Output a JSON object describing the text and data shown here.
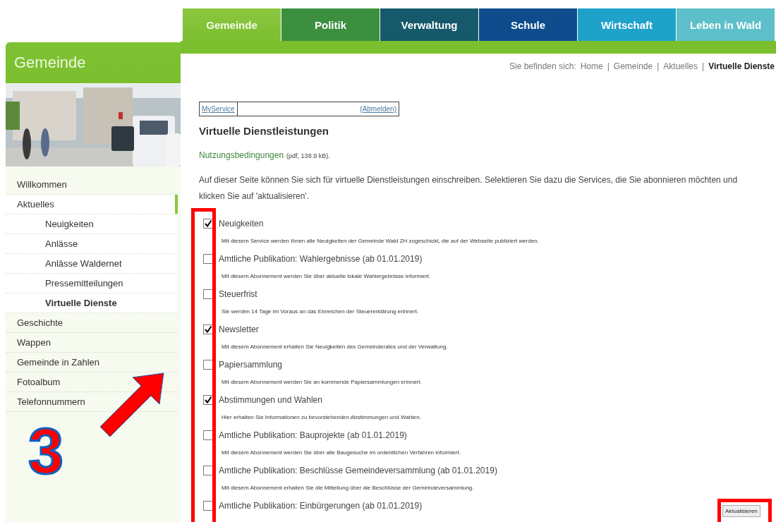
{
  "tabs": [
    {
      "label": "Gemeinde",
      "selected": true,
      "color": "#8cc63f"
    },
    {
      "label": "Politik",
      "selected": false,
      "color": "#3b8f3e"
    },
    {
      "label": "Verwaltung",
      "selected": false,
      "color": "#15596b"
    },
    {
      "label": "Schule",
      "selected": false,
      "color": "#0e4c8e"
    },
    {
      "label": "Wirtschaft",
      "selected": false,
      "color": "#1ea2c9"
    },
    {
      "label": "Leben in Wald",
      "selected": false,
      "color": "#5dbfc9"
    }
  ],
  "sidebar": {
    "title": "Gemeinde",
    "items": [
      {
        "label": "Willkommen",
        "selected": false,
        "expanded": false
      },
      {
        "label": "Aktuelles",
        "selected": false,
        "expanded": true,
        "children": [
          {
            "label": "Neuigkeiten",
            "selected": false
          },
          {
            "label": "Anlässe",
            "selected": false
          },
          {
            "label": "Anlässe Waldernet",
            "selected": false
          },
          {
            "label": "Pressemitteilungen",
            "selected": false
          },
          {
            "label": "Virtuelle Dienste",
            "selected": true
          }
        ]
      },
      {
        "label": "Geschichte",
        "selected": false,
        "expanded": false
      },
      {
        "label": "Wappen",
        "selected": false,
        "expanded": false
      },
      {
        "label": "Gemeinde in Zahlen",
        "selected": false,
        "expanded": false
      },
      {
        "label": "Fotoalbum",
        "selected": false,
        "expanded": false
      },
      {
        "label": "Telefonnummern",
        "selected": false,
        "expanded": false
      }
    ]
  },
  "breadcrumb": {
    "prefix": "Sie befinden sich:",
    "separator": "|",
    "items": [
      {
        "label": "Home",
        "selected": false
      },
      {
        "label": "Gemeinde",
        "selected": false
      },
      {
        "label": "Aktuelles",
        "selected": false
      },
      {
        "label": "Virtuelle Dienste",
        "selected": true
      }
    ]
  },
  "myservice": {
    "link": "MyService",
    "logout": "(Abmelden)"
  },
  "heading": "Virtuelle Dienstleistungen",
  "terms": {
    "link": "Nutzungsbedingungen",
    "info": "(pdf, 138.9 kB)."
  },
  "intro": "Auf dieser Seite können Sie sich für virtuelle Dienstleistungen einschreiben. Selektieren Sie dazu die Services, die Sie abonnieren möchten und klicken Sie auf 'aktualisieren'.",
  "services": [
    {
      "label": "Neuigkeiten",
      "checked": true,
      "description": "Mit diesem Service werden Ihnen alle Neuigkeiten der Gemeinde Wald ZH zugeschickt, die auf der Webseite publiziert werden."
    },
    {
      "label": "Amtliche Publikation: Wahlergebnisse (ab 01.01.2019)",
      "checked": false,
      "description": "Mit diesem Abonnement werden Sie über aktuelle lokale Wahlergebnisse informiert."
    },
    {
      "label": "Steuerfrist",
      "checked": false,
      "description": "Sie werden 14 Tage im Voraus an das Einreichen der Steuererklärung erinnert."
    },
    {
      "label": "Newsletter",
      "checked": true,
      "description": "Mit diesem Abonnement erhalten Sie Neuigkeiten des Gemeinderates und der Verwaltung."
    },
    {
      "label": "Papiersammlung",
      "checked": false,
      "description": "Mit diesem Abonnement werden Sie an kommende Papiersammlungen erinnert."
    },
    {
      "label": "Abstimmungen und Wahlen",
      "checked": true,
      "description": "Hier erhalten Sie Informationen zu bevorstehenden Abstimmungen und Wahlen."
    },
    {
      "label": "Amtliche Publikation: Bauprojekte (ab 01.01.2019)",
      "checked": false,
      "description": "Mit diesem Abonnement werden Sie über alle Baugesuche im ordentlichen Verfahren informiert."
    },
    {
      "label": "Amtliche Publikation: Beschlüsse Gemeindeversammlung (ab 01.01.2019)",
      "checked": false,
      "description": "Mit diesem Abonnement erhalten Sie die Mitteilung über die Beschlüsse der Gemeindeversammlung."
    },
    {
      "label": "Amtliche Publikation: Einbürgerungen (ab 01.01.2019)",
      "checked": false
    }
  ],
  "update_button": "Aktualisieren",
  "annotation": {
    "number": "3"
  }
}
